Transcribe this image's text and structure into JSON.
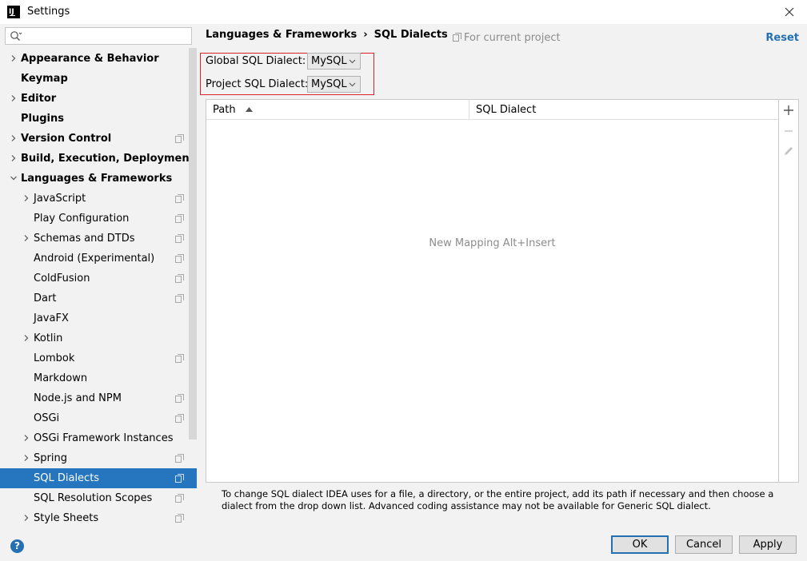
{
  "window": {
    "title": "Settings"
  },
  "search": {
    "placeholder": ""
  },
  "sidebar": {
    "items": [
      {
        "label": "Appearance & Behavior",
        "level": 0,
        "bold": true,
        "arrow": "right",
        "proj": false
      },
      {
        "label": "Keymap",
        "level": 0,
        "bold": true,
        "arrow": "none",
        "proj": false
      },
      {
        "label": "Editor",
        "level": 0,
        "bold": true,
        "arrow": "right",
        "proj": false
      },
      {
        "label": "Plugins",
        "level": 0,
        "bold": true,
        "arrow": "none",
        "proj": false
      },
      {
        "label": "Version Control",
        "level": 0,
        "bold": true,
        "arrow": "right",
        "proj": true
      },
      {
        "label": "Build, Execution, Deployment",
        "level": 0,
        "bold": true,
        "arrow": "right",
        "proj": false
      },
      {
        "label": "Languages & Frameworks",
        "level": 0,
        "bold": true,
        "arrow": "down",
        "proj": false
      },
      {
        "label": "JavaScript",
        "level": 1,
        "bold": false,
        "arrow": "right",
        "proj": true
      },
      {
        "label": "Play Configuration",
        "level": 1,
        "bold": false,
        "arrow": "none",
        "proj": true
      },
      {
        "label": "Schemas and DTDs",
        "level": 1,
        "bold": false,
        "arrow": "right",
        "proj": true
      },
      {
        "label": "Android (Experimental)",
        "level": 1,
        "bold": false,
        "arrow": "none",
        "proj": true
      },
      {
        "label": "ColdFusion",
        "level": 1,
        "bold": false,
        "arrow": "none",
        "proj": true
      },
      {
        "label": "Dart",
        "level": 1,
        "bold": false,
        "arrow": "none",
        "proj": true
      },
      {
        "label": "JavaFX",
        "level": 1,
        "bold": false,
        "arrow": "none",
        "proj": false
      },
      {
        "label": "Kotlin",
        "level": 1,
        "bold": false,
        "arrow": "right",
        "proj": false
      },
      {
        "label": "Lombok",
        "level": 1,
        "bold": false,
        "arrow": "none",
        "proj": true
      },
      {
        "label": "Markdown",
        "level": 1,
        "bold": false,
        "arrow": "none",
        "proj": false
      },
      {
        "label": "Node.js and NPM",
        "level": 1,
        "bold": false,
        "arrow": "none",
        "proj": true
      },
      {
        "label": "OSGi",
        "level": 1,
        "bold": false,
        "arrow": "none",
        "proj": true
      },
      {
        "label": "OSGi Framework Instances",
        "level": 1,
        "bold": false,
        "arrow": "right",
        "proj": false
      },
      {
        "label": "Spring",
        "level": 1,
        "bold": false,
        "arrow": "right",
        "proj": true
      },
      {
        "label": "SQL Dialects",
        "level": 1,
        "bold": false,
        "arrow": "none",
        "proj": true,
        "selected": true
      },
      {
        "label": "SQL Resolution Scopes",
        "level": 1,
        "bold": false,
        "arrow": "none",
        "proj": true
      },
      {
        "label": "Style Sheets",
        "level": 1,
        "bold": false,
        "arrow": "right",
        "proj": true
      }
    ]
  },
  "breadcrumb": {
    "parent": "Languages & Frameworks",
    "separator": "›",
    "current": "SQL Dialects"
  },
  "for_project": "For current project",
  "reset_label": "Reset",
  "global_dialect": {
    "label": "Global SQL Dialect:",
    "value": "MySQL"
  },
  "project_dialect": {
    "label": "Project SQL Dialect:",
    "value": "MySQL"
  },
  "table": {
    "columns": [
      "Path",
      "SQL Dialect"
    ],
    "empty_text": "New Mapping Alt+Insert"
  },
  "hint": "To change SQL dialect IDEA uses for a file, a directory, or the entire project, add its path if necessary and then choose a dialect from the drop down list. Advanced coding assistance may not be available for Generic SQL dialect.",
  "buttons": {
    "ok": "OK",
    "cancel": "Cancel",
    "apply": "Apply"
  },
  "help": "?",
  "colors": {
    "selection": "#2675bf",
    "link": "#2470b3",
    "highlight_box": "#d9222a"
  }
}
